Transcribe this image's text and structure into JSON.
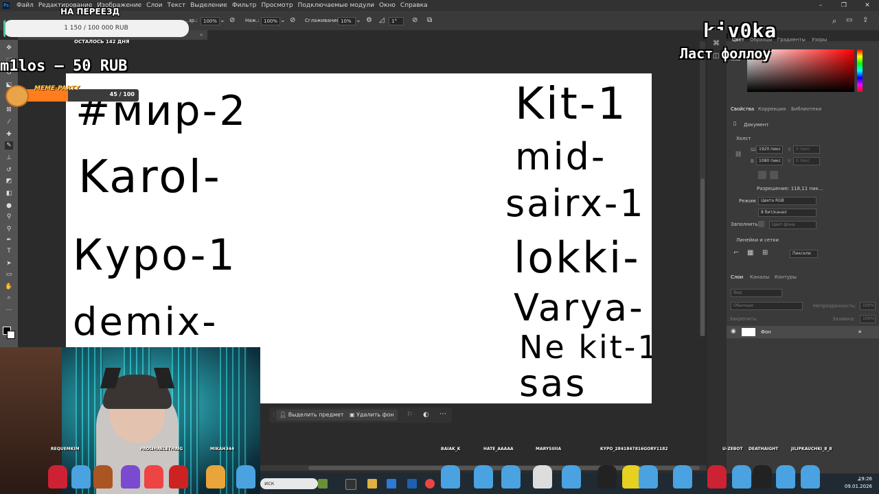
{
  "menubar": {
    "items": [
      "Файл",
      "Редактирование",
      "Изображение",
      "Слои",
      "Текст",
      "Выделение",
      "Фильтр",
      "Просмотр",
      "Подключаемые модули",
      "Окно",
      "Справка"
    ]
  },
  "options": {
    "opacity_label": "…зр.:",
    "opacity_value": "100%",
    "pressure_label": "Наж.:",
    "pressure_value": "100%",
    "smoothing_label": "Сглаживание:",
    "smoothing_value": "10%",
    "angle_value": "1°"
  },
  "overlay": {
    "goal_title": "НА ПЕРЕЕЗД",
    "goal_amount": "1 150 / 100 000 RUB",
    "goal_progress": 0.0115,
    "goal_days_left": "ОСТАЛОСЬ 142 ДНЯ",
    "ticker_text": "m1los – 50 RUB",
    "meme_label": "MEME-PARTY",
    "meme_value": "45 / 100",
    "meme_progress": 0.45,
    "streamer_name": "kiv0ka",
    "last_follow": "Ласт фоллоу"
  },
  "canvas": {
    "left_entries": [
      "#мир-2",
      "Karol-",
      "Кypo-1",
      "demix-"
    ],
    "right_entries": [
      "Kit-1",
      "mid-",
      "sairx-1",
      "lokki-",
      "Varya-",
      "Ne kit-1",
      "sas"
    ]
  },
  "context_bar": {
    "select_subject": "Выделить предмет",
    "remove_bg": "Удалить фон"
  },
  "panels": {
    "tabs_top": [
      "Цвет",
      "Образцы",
      "Градиенты",
      "Узоры"
    ],
    "props_tabs": [
      "Свойства",
      "Коррекция",
      "Библиотеки"
    ],
    "document_label": "Документ",
    "canvas_section": "Холст",
    "width_label": "Ш",
    "width_value": "1920 пикс",
    "height_label": "В",
    "height_value": "1080 пикс",
    "x_label": "X",
    "x_value": "0 пикс",
    "y_label": "Y",
    "y_value": "0 пикс",
    "resolution": "Разрешение: 118,11 пик...",
    "mode_label": "Режим",
    "mode_value": "Цвета RGB",
    "depth_value": "8 бит/канал",
    "fill_label": "Заполнить",
    "fill_value": "Цвет фона",
    "rulers_section": "Линейки и сетки",
    "units_value": "Пиксели",
    "layers_tabs": [
      "Слои",
      "Каналы",
      "Контуры"
    ],
    "layer_search": "Вид",
    "blend_mode": "Обычные",
    "opacity_label": "Непрозрачность:",
    "opacity_value": "100%",
    "lock_label": "Закрепить:",
    "fill2_label": "Заливка:",
    "fill2_value": "100%",
    "layer_name": "Фон"
  },
  "chatters": [
    "REQUEMKIM",
    "PAOLIHAELETHAIG",
    "MIKAH344",
    "BAIAK_K",
    "HATE_AAAAA",
    "MARYSIIIIA",
    "KYPO_2841847816GORY1182",
    "U-ZEBOT",
    "DEATHAIGHT",
    "JILIPKAUCHKI_8_8"
  ],
  "taskbar": {
    "search": "иск",
    "time": "19:26",
    "date": "09.01.2026"
  }
}
